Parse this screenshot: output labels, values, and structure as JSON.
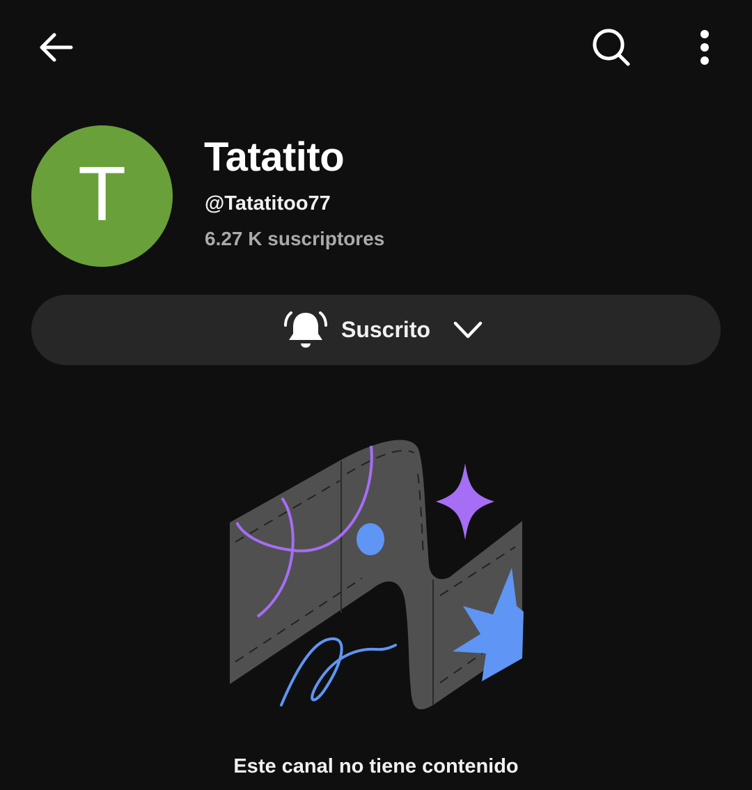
{
  "header": {
    "icons": [
      "arrow-left-icon",
      "search-icon",
      "more-vertical-icon"
    ]
  },
  "channel": {
    "avatar_letter": "T",
    "avatar_color": "#69a03a",
    "name": "Tatatito",
    "handle": "@Tatatitoo77",
    "subscribers": "6.27 K suscriptores"
  },
  "subscribe_button": {
    "label": "Suscrito",
    "icon": "bell-icon",
    "dropdown_icon": "chevron-down-icon"
  },
  "empty_state": {
    "message": "Este canal no tiene contenido",
    "accent_colors": [
      "#a56ef5",
      "#5f95f4",
      "#505050"
    ]
  }
}
